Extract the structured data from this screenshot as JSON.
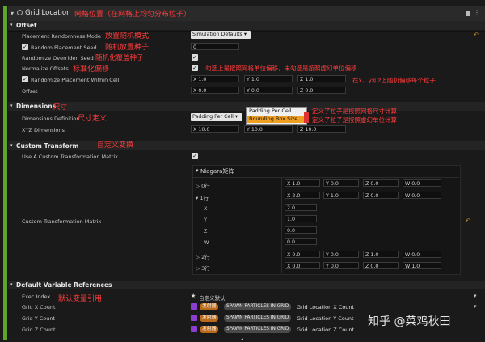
{
  "title": "Grid Location",
  "title_note": "网格位置（在网格上均匀分布粒子）",
  "sections": {
    "offset": "Offset",
    "dimensions": "Dimensions",
    "dimensions_note": "尺寸",
    "custom_transform": "Custom Transform",
    "custom_transform_note": "自定义变换",
    "default_refs": "Default Variable References",
    "default_refs_note": "默认变量引用"
  },
  "offset": {
    "placement_mode": {
      "label": "Placement Randomness Mode",
      "value": "Simulation Defaults",
      "note": "放置随机模式"
    },
    "random_seed": {
      "label": "Random Placement Seed",
      "value": "0",
      "note": "随机放置种子",
      "checked": true
    },
    "randomize_overriden": {
      "label": "Randomize Overriden Seed",
      "note": "随机化覆盖种子",
      "checked": true
    },
    "normalize_offsets": {
      "label": "Normalize Offsets",
      "note": "标准化偏移",
      "checked": true,
      "note2": "勾选上是按照网格单位偏移，未勾选是按照虚幻单位偏移"
    },
    "randomize_within_cell": {
      "label": "Randomize Placement Within Cell",
      "checked": true,
      "x": "X 1.0",
      "y": "Y 1.0",
      "z": "Z 1.0",
      "note": "在x、y和z上随机偏移每个粒子"
    },
    "offset": {
      "label": "Offset",
      "x": "X 0.0",
      "y": "Y 0.0",
      "z": "Z 0.0"
    }
  },
  "dimensions": {
    "definition": {
      "label": "Dimensions Definition",
      "value": "Padding Per Cell",
      "note": "尺寸定义"
    },
    "dropdown": [
      "Padding Per Cell",
      "Bounding Box Size"
    ],
    "dropdown_notes": [
      "定义了粒子是按照网格尺寸计算",
      "定义了粒子是按照虚幻单位计算"
    ],
    "xyz": {
      "label": "XYZ Dimensions",
      "x": "X 10.0",
      "y": "Y 10.0",
      "z": "Z 10.0"
    }
  },
  "custom": {
    "use_label": "Use A Custom Transformation Matrix",
    "use_checked": true,
    "matrix_label": "Custom Transformation Matrix",
    "matrix_title": "Niagara矩阵",
    "rows": [
      {
        "name": "0行",
        "x": "X 1.0",
        "y": "Y 0.0",
        "z": "Z 0.0",
        "w": "W 0.0"
      },
      {
        "name": "1行",
        "x": "X 2.0",
        "y": "Y 1.0",
        "z": "Z 0.0",
        "w": "W 0.0"
      }
    ],
    "expanded": [
      {
        "axis": "X",
        "value": "2.0"
      },
      {
        "axis": "Y",
        "value": "1.0"
      },
      {
        "axis": "Z",
        "value": "0.0"
      },
      {
        "axis": "W",
        "value": "0.0"
      }
    ],
    "rows2": [
      {
        "name": "2行",
        "x": "X 0.0",
        "y": "Y 0.0",
        "z": "Z 1.0",
        "w": "W 0.0"
      },
      {
        "name": "3行",
        "x": "X 0.0",
        "y": "Y 0.0",
        "z": "Z 0.0",
        "w": "W 1.0"
      }
    ]
  },
  "refs": {
    "exec_index": {
      "label": "Exec Index",
      "value": "自定义默认"
    },
    "items": [
      {
        "label": "Grid X Count",
        "tag": "发射器",
        "module": "SPAWN PARTICLES IN GRID",
        "value": "Grid Location X Count"
      },
      {
        "label": "Grid Y Count",
        "tag": "发射器",
        "module": "SPAWN PARTICLES IN GRID",
        "value": "Grid Location Y Count"
      },
      {
        "label": "Grid Z Count",
        "tag": "发射器",
        "module": "SPAWN PARTICLES IN GRID",
        "value": "Grid Location Z Count"
      }
    ]
  },
  "watermark": "知乎 @菜鸡秋田"
}
